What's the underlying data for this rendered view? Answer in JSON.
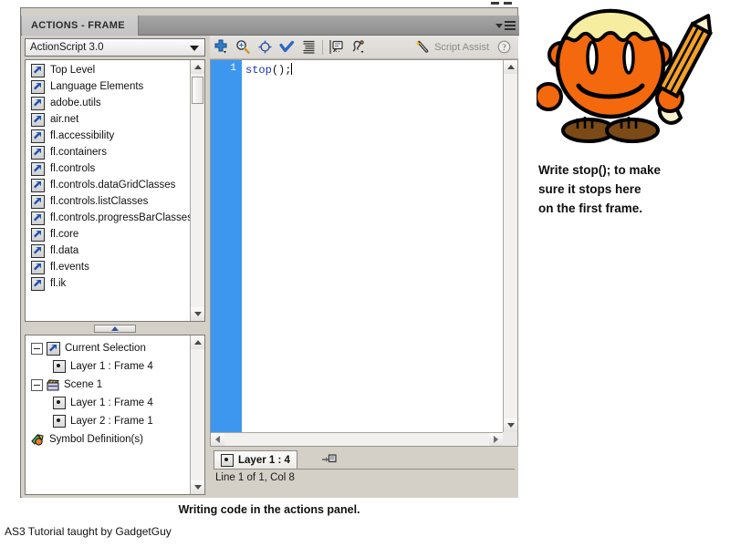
{
  "panel": {
    "tab_title": "ACTIONS - FRAME",
    "menu_icon": "panel-menu-icon",
    "script_version": "ActionScript 3.0"
  },
  "class_tree": {
    "items": [
      {
        "label": "Top Level",
        "icon": "package-icon"
      },
      {
        "label": "Language Elements",
        "icon": "package-icon"
      },
      {
        "label": "adobe.utils",
        "icon": "package-icon"
      },
      {
        "label": "air.net",
        "icon": "package-icon"
      },
      {
        "label": "fl.accessibility",
        "icon": "package-icon"
      },
      {
        "label": "fl.containers",
        "icon": "package-icon"
      },
      {
        "label": "fl.controls",
        "icon": "package-icon"
      },
      {
        "label": "fl.controls.dataGridClasses",
        "icon": "package-icon"
      },
      {
        "label": "fl.controls.listClasses",
        "icon": "package-icon"
      },
      {
        "label": "fl.controls.progressBarClasses",
        "icon": "package-icon"
      },
      {
        "label": "fl.core",
        "icon": "package-icon"
      },
      {
        "label": "fl.data",
        "icon": "package-icon"
      },
      {
        "label": "fl.events",
        "icon": "package-icon"
      },
      {
        "label": "fl.ik",
        "icon": "package-icon"
      }
    ]
  },
  "scene_tree": {
    "items": [
      {
        "label": "Current Selection",
        "icon": "package-icon",
        "indent": 0,
        "expander": "minus"
      },
      {
        "label": "Layer 1 : Frame 4",
        "icon": "frame-icon",
        "indent": 1,
        "expander": "none"
      },
      {
        "label": "Scene 1",
        "icon": "scene-icon",
        "indent": 0,
        "expander": "minus"
      },
      {
        "label": "Layer 1 : Frame 4",
        "icon": "frame-icon",
        "indent": 1,
        "expander": "none"
      },
      {
        "label": "Layer 2 : Frame 1",
        "icon": "frame-icon",
        "indent": 1,
        "expander": "none"
      },
      {
        "label": "Symbol Definition(s)",
        "icon": "symbol-icon",
        "indent": 0,
        "expander": "none"
      }
    ]
  },
  "toolbar": {
    "buttons": [
      {
        "name": "add-script-icon",
        "tip": "Add a new item to the script"
      },
      {
        "name": "find-replace-icon",
        "tip": "Find"
      },
      {
        "name": "insert-target-path-icon",
        "tip": "Insert target path"
      },
      {
        "name": "check-syntax-icon",
        "tip": "Check syntax"
      },
      {
        "name": "auto-format-icon",
        "tip": "Auto format"
      },
      {
        "name": "show-code-hint-icon",
        "tip": "Show code hint"
      },
      {
        "name": "debug-options-icon",
        "tip": "Debug options"
      }
    ],
    "script_assist_label": "Script Assist",
    "script_assist_icon": "magic-wand-icon",
    "help_icon": "help-icon"
  },
  "editor": {
    "line_number": "1",
    "code_keyword": "stop",
    "code_rest": "();"
  },
  "status": {
    "layer_tab": "Layer 1 : 4",
    "pin_icon": "pin-script-icon",
    "line_info": "Line 1 of 1, Col 8"
  },
  "caption": "Writing code in the actions panel.",
  "footer": "AS3 Tutorial taught by GadgetGuy",
  "annotation": {
    "line1": "Write stop(); to make",
    "line2": "sure it stops here",
    "line3": "on the first frame."
  },
  "colors": {
    "gutter_blue": "#3e97ee",
    "keyword_blue": "#1b33b4",
    "panel_gray": "#d4d0c8",
    "mascot_orange": "#f4690d",
    "mascot_hair": "#f7eda0",
    "mascot_shoe": "#7b4a16"
  }
}
